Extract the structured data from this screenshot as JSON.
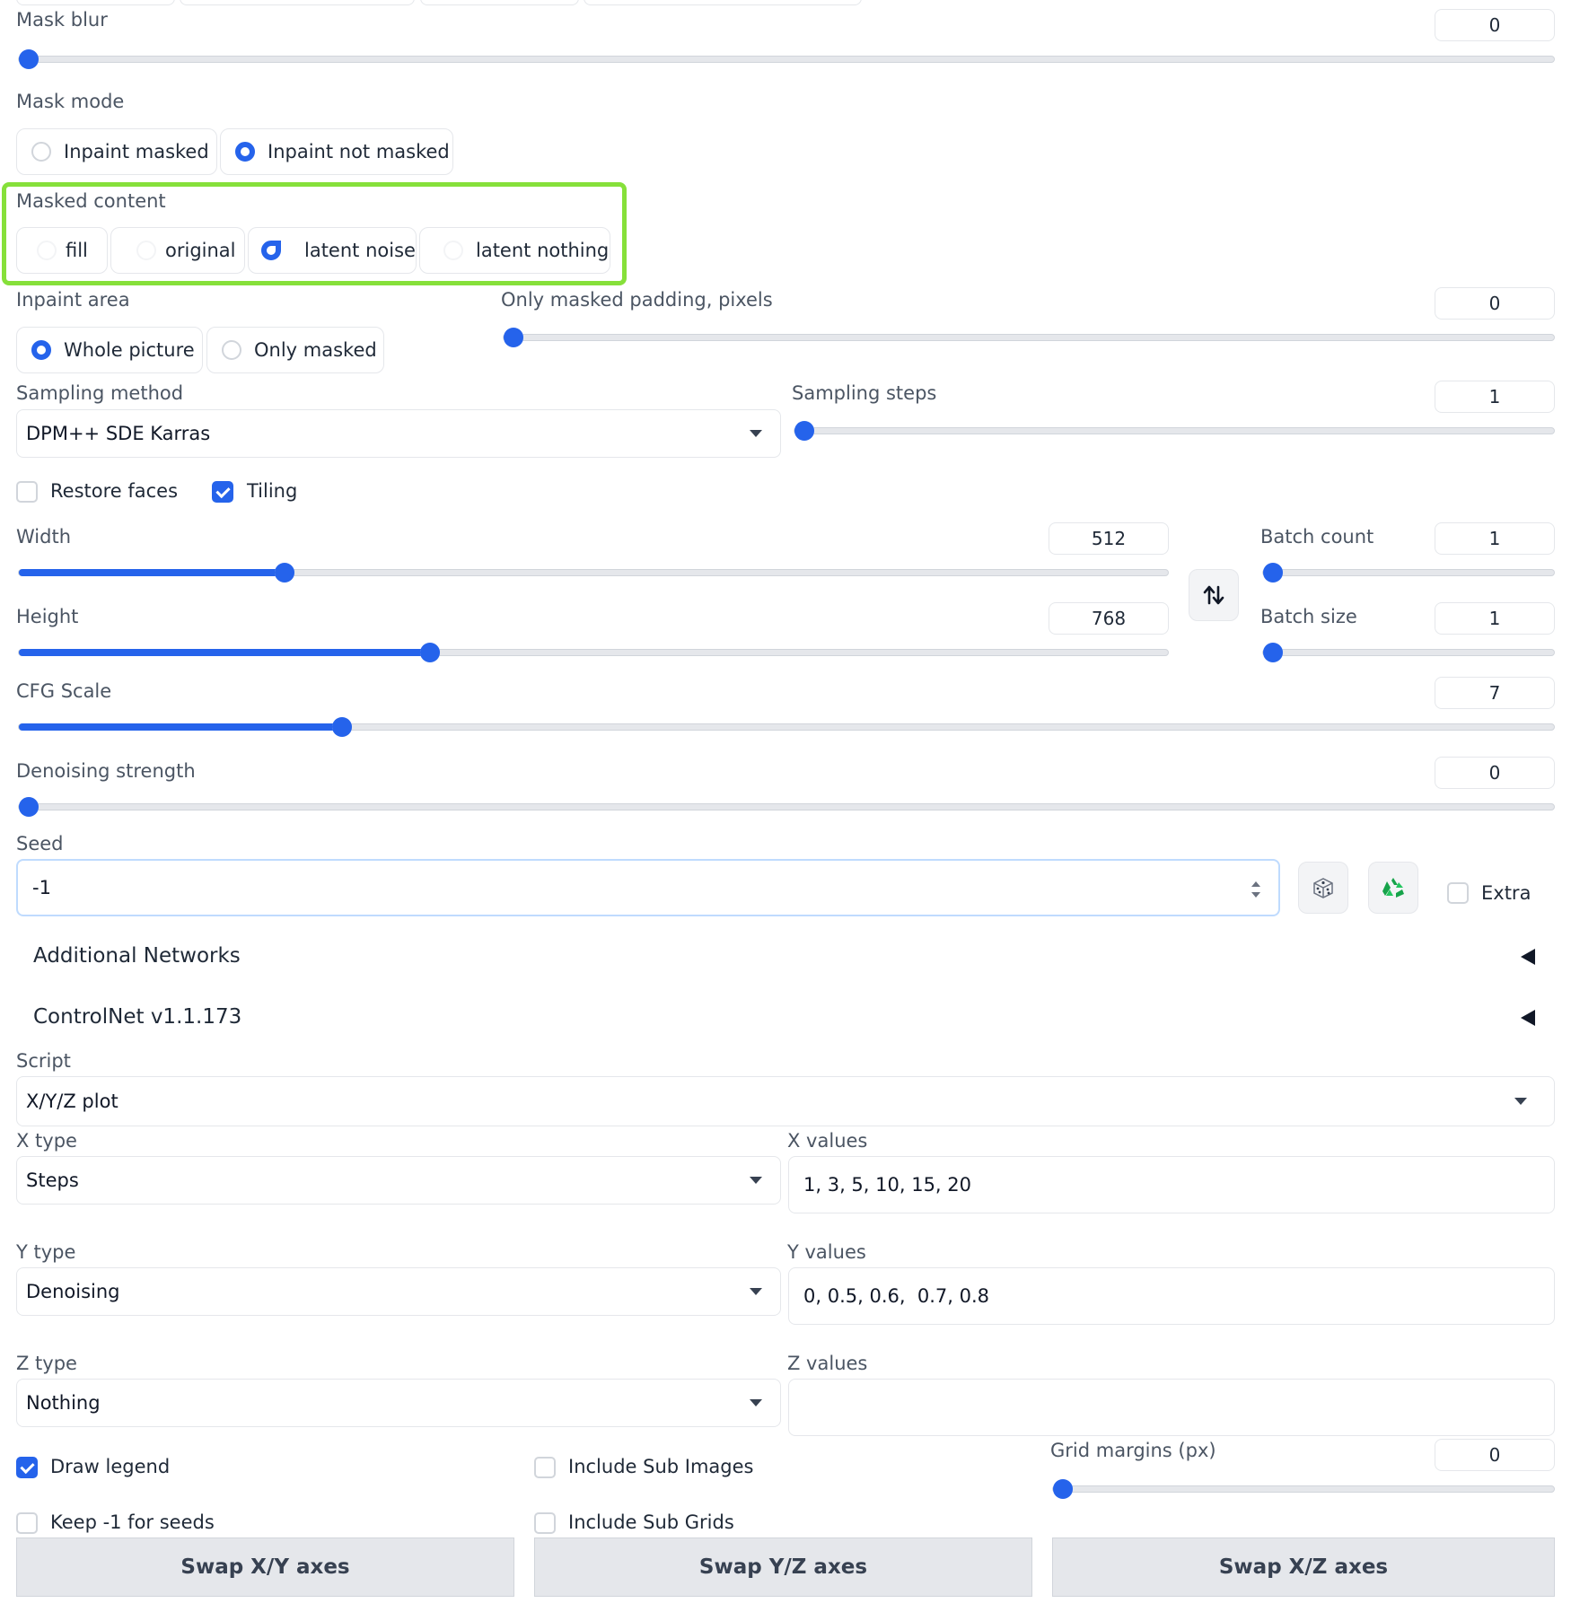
{
  "mask_blur": {
    "label": "Mask blur",
    "value": "0",
    "fraction": 0
  },
  "mask_mode": {
    "label": "Mask mode",
    "options": [
      "Inpaint masked",
      "Inpaint not masked"
    ],
    "selected": "Inpaint not masked"
  },
  "masked_content": {
    "label": "Masked content",
    "options": [
      "fill",
      "original",
      "latent noise",
      "latent nothing"
    ],
    "selected": "latent noise",
    "highlight_color": "#86e03a"
  },
  "inpaint_area": {
    "label": "Inpaint area",
    "options": [
      "Whole picture",
      "Only masked"
    ],
    "selected": "Whole picture"
  },
  "only_masked_padding": {
    "label": "Only masked padding, pixels",
    "value": "0",
    "fraction": 0
  },
  "sampling_method": {
    "label": "Sampling method",
    "value": "DPM++ SDE Karras"
  },
  "sampling_steps": {
    "label": "Sampling steps",
    "value": "1",
    "fraction": 0
  },
  "restore_faces": {
    "label": "Restore faces",
    "checked": false
  },
  "tiling": {
    "label": "Tiling",
    "checked": true
  },
  "width": {
    "label": "Width",
    "value": "512",
    "fraction": 0.231
  },
  "height": {
    "label": "Height",
    "value": "768",
    "fraction": 0.358
  },
  "batch_count": {
    "label": "Batch count",
    "value": "1",
    "fraction": 0
  },
  "batch_size": {
    "label": "Batch size",
    "value": "1",
    "fraction": 0
  },
  "cfg_scale": {
    "label": "CFG Scale",
    "value": "7",
    "fraction": 0.211
  },
  "denoising_strength": {
    "label": "Denoising strength",
    "value": "0",
    "fraction": 0
  },
  "seed": {
    "label": "Seed",
    "value": "-1",
    "extra_label": "Extra"
  },
  "accordions": {
    "additional_networks": "Additional Networks",
    "controlnet": "ControlNet v1.1.173"
  },
  "script": {
    "label": "Script",
    "value": "X/Y/Z plot"
  },
  "x_type": {
    "label": "X type",
    "value": "Steps"
  },
  "x_values": {
    "label": "X values",
    "value": "1, 3, 5, 10, 15, 20"
  },
  "y_type": {
    "label": "Y type",
    "value": "Denoising"
  },
  "y_values": {
    "label": "Y values",
    "value": "0, 0.5, 0.6,  0.7, 0.8"
  },
  "z_type": {
    "label": "Z type",
    "value": "Nothing"
  },
  "z_values": {
    "label": "Z values",
    "value": ""
  },
  "draw_legend": {
    "label": "Draw legend",
    "checked": true
  },
  "include_sub_images": {
    "label": "Include Sub Images",
    "checked": false
  },
  "keep_seeds": {
    "label": "Keep -1 for seeds",
    "checked": false
  },
  "include_sub_grids": {
    "label": "Include Sub Grids",
    "checked": false
  },
  "grid_margins": {
    "label": "Grid margins (px)",
    "value": "0",
    "fraction": 0
  },
  "swap_buttons": {
    "xy": "Swap X/Y axes",
    "yz": "Swap Y/Z axes",
    "xz": "Swap X/Z axes"
  },
  "icons": {
    "dice": "dice-icon",
    "recycle": "recycle-icon",
    "swap": "swap-dimensions-icon"
  },
  "accent_color": "#2563eb"
}
